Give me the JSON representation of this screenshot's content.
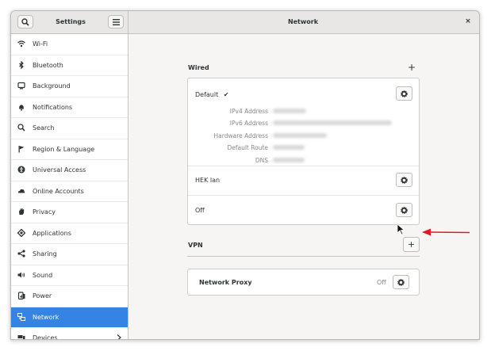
{
  "header": {
    "left_title": "Settings",
    "main_title": "Network",
    "close_glyph": "×"
  },
  "sidebar": {
    "items": [
      {
        "label": "Wi-Fi",
        "icon": "wifi-icon"
      },
      {
        "label": "Bluetooth",
        "icon": "bluetooth-icon"
      },
      {
        "label": "Background",
        "icon": "background-icon"
      },
      {
        "label": "Notifications",
        "icon": "bell-icon"
      },
      {
        "label": "Search",
        "icon": "search-icon"
      },
      {
        "label": "Region & Language",
        "icon": "flag-icon"
      },
      {
        "label": "Universal Access",
        "icon": "accessibility-icon"
      },
      {
        "label": "Online Accounts",
        "icon": "cloud-icon"
      },
      {
        "label": "Privacy",
        "icon": "hand-icon"
      },
      {
        "label": "Applications",
        "icon": "applications-icon"
      },
      {
        "label": "Sharing",
        "icon": "share-icon"
      },
      {
        "label": "Sound",
        "icon": "speaker-icon"
      },
      {
        "label": "Power",
        "icon": "power-icon"
      },
      {
        "label": "Network",
        "icon": "network-icon",
        "active": true
      },
      {
        "label": "Devices",
        "icon": "devices-icon"
      }
    ]
  },
  "wired": {
    "title": "Wired",
    "add_glyph": "+",
    "default_label": "Default",
    "check_glyph": "✔",
    "details": [
      {
        "label": "IPv4 Address"
      },
      {
        "label": "IPv6 Address"
      },
      {
        "label": "Hardware Address"
      },
      {
        "label": "Default Route"
      },
      {
        "label": "DNS"
      }
    ],
    "hek_label": "HEK lan",
    "off_label": "Off"
  },
  "vpn": {
    "title": "VPN",
    "add_glyph": "+"
  },
  "proxy": {
    "label": "Network Proxy",
    "status": "Off"
  },
  "colors": {
    "accent": "#3584e4",
    "annotation_arrow": "#e01b24"
  }
}
